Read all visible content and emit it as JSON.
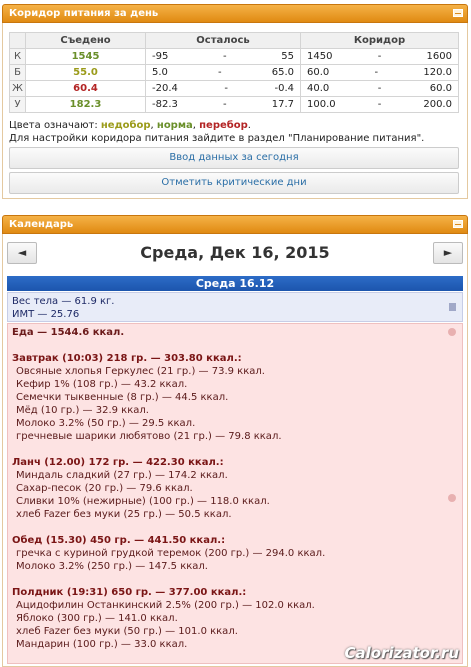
{
  "panel1": {
    "title": "Коридор питания за день",
    "headers": {
      "eaten": "Съедено",
      "remaining": "Осталось",
      "corridor": "Коридор"
    },
    "rows": [
      {
        "label": "К",
        "eaten": "1545",
        "rem_from": "-95",
        "rem_to": "55",
        "cor_from": "1450",
        "cor_to": "1600",
        "status": "ok"
      },
      {
        "label": "Б",
        "eaten": "55.0",
        "rem_from": "5.0",
        "rem_to": "65.0",
        "cor_from": "60.0",
        "cor_to": "120.0",
        "status": "under"
      },
      {
        "label": "Ж",
        "eaten": "60.4",
        "rem_from": "-20.4",
        "rem_to": "-0.4",
        "cor_from": "40.0",
        "cor_to": "60.0",
        "status": "over"
      },
      {
        "label": "У",
        "eaten": "182.3",
        "rem_from": "-82.3",
        "rem_to": "17.7",
        "cor_from": "100.0",
        "cor_to": "200.0",
        "status": "ok"
      }
    ],
    "dash": "-",
    "legend_prefix": "Цвета означают:",
    "legend_under": "недобор",
    "legend_ok": "норма",
    "legend_over": "перебор",
    "note": "Для настройки коридора питания зайдите в раздел \"Планирование питания\".",
    "btn_today": "Ввод данных за сегодня",
    "btn_critical": "Отметить критические дни"
  },
  "colors": {
    "ok": "#6a8f2a",
    "under": "#9b9b1a",
    "over": "#b32424",
    "header": "#e8951c",
    "daybar": "#2360ba"
  },
  "panel2": {
    "title": "Календарь",
    "prev": "◄",
    "next": "►",
    "date": "Среда, Дек 16, 2015",
    "day": "Среда 16.12",
    "weight_line": "Вес тела — 61.9 кг.",
    "bmi_line": "ИМТ — 25.76",
    "food_total": "Еда — 1544.6 ккал.",
    "meals": [
      {
        "title": "Завтрак (10:03) 218 гр. — 303.80 ккал.:",
        "items": [
          "Овсяные хлопья Геркулес (21 гр.) — 73.9 ккал.",
          "Кефир 1% (108 гр.) — 43.2 ккал.",
          "Семечки тыквенные (8 гр.) — 44.5 ккал.",
          "Мёд (10 гр.) — 32.9 ккал.",
          "Молоко 3.2% (50 гр.) — 29.5 ккал.",
          "гречневые шарики любятово (21 гр.) — 79.8 ккал."
        ]
      },
      {
        "title": "Ланч (12.00) 172 гр. — 422.30 ккал.:",
        "items": [
          "Миндаль сладкий (27 гр.) — 174.2 ккал.",
          "Сахар-песок (20 гр.) — 79.6 ккал.",
          "Сливки 10% (нежирные) (100 гр.) — 118.0 ккал.",
          "хлеб Fazer без муки (25 гр.) — 50.5 ккал."
        ]
      },
      {
        "title": "Обед (15.30) 450 гр. — 441.50 ккал.:",
        "items": [
          "гречка с куриной грудкой теремок (200 гр.) — 294.0 ккал.",
          "Молоко 3.2% (250 гр.) — 147.5 ккал."
        ]
      },
      {
        "title": "Полдник (19:31) 650 гр. — 377.00 ккал.:",
        "items": [
          "Ацидофилин Останкинский 2.5% (200 гр.) — 102.0 ккал.",
          "Яблоко (300 гр.) — 141.0 ккал.",
          "хлеб Fazer без муки (50 гр.) — 101.0 ккал.",
          "Мандарин (100 гр.) — 33.0 ккал."
        ]
      }
    ]
  },
  "watermark": "Calorizator.ru"
}
